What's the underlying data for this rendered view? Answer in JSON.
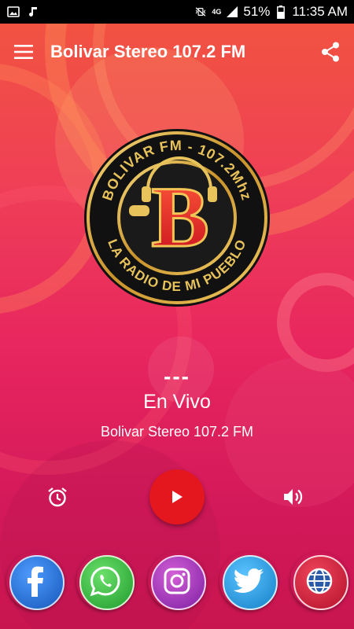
{
  "status_bar": {
    "battery": "51%",
    "network_type": "4G",
    "time": "11:35 AM",
    "icons": [
      "image-icon",
      "music-note-icon",
      "vibrate-mute-icon",
      "signal-icon",
      "battery-icon"
    ]
  },
  "toolbar": {
    "title": "Bolivar Stereo 107.2 FM",
    "menu_icon": "hamburger-menu-icon",
    "share_icon": "share-icon"
  },
  "logo": {
    "ring_text_top": "BOLIVAR FM - 107.2Mhz",
    "ring_text_bottom": "LA RADIO DE MI PUEBLO",
    "letter": "B"
  },
  "now_playing": {
    "dashes": "---",
    "title": "En Vivo",
    "station": "Bolivar Stereo 107.2 FM"
  },
  "controls": {
    "alarm_icon": "alarm-clock-icon",
    "play_icon": "play-icon",
    "volume_icon": "volume-icon"
  },
  "social": [
    {
      "name": "facebook",
      "icon": "facebook-icon",
      "color": "#1d6fd6"
    },
    {
      "name": "whatsapp",
      "icon": "whatsapp-icon",
      "color": "#2fbf3f"
    },
    {
      "name": "instagram",
      "icon": "instagram-icon",
      "color": "#b42fb8"
    },
    {
      "name": "twitter",
      "icon": "twitter-icon",
      "color": "#1da1f2"
    },
    {
      "name": "website",
      "icon": "globe-icon",
      "color": "#d01f3a"
    }
  ],
  "colors": {
    "background_top": "#f2553e",
    "background_bottom": "#c8154f",
    "play_button": "#e4171f",
    "logo_gold": "#d9a93a",
    "logo_red": "#e0262c"
  }
}
